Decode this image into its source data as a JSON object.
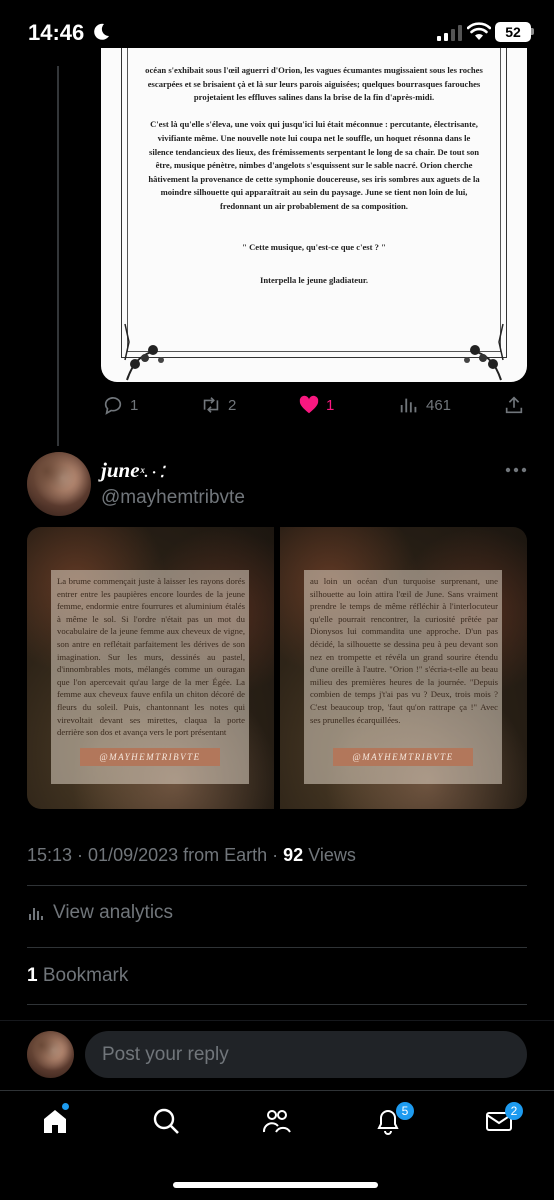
{
  "status": {
    "time": "14:46",
    "battery": "52"
  },
  "card": {
    "paragraphs": [
      "océan s'exhibait sous l'œil aguerri d'Orion, les vagues écumantes mugissaient sous les roches escarpées et se brisaient çà et là sur leurs parois aiguisées; quelques bourrasques farouches projetaient les effluves salines dans la brise de la fin d'après-midi.",
      "C'est là qu'elle s'éleva, une voix qui jusqu'ici lui était méconnue : percutante, électrisante, vivifiante même. Une nouvelle note lui coupa net le souffle, un hoquet résonna dans le silence tendancieux des lieux, des frémissements serpentant le long de sa chair. De tout son être, musique pénètre, nimbes d'angelots s'esquissent sur le sable nacré. Orion cherche hâtivement la provenance de cette symphonie doucereuse, ses iris sombres aux aguets de la moindre silhouette qui apparaîtrait au sein du paysage. June se tient non loin de lui, fredonnant un air probablement de sa composition.",
      "\" Cette musique, qu'est-ce que c'est ? \"",
      "Interpella le jeune gladiateur."
    ]
  },
  "actions_first": {
    "replies": "1",
    "reposts": "2",
    "likes": "1",
    "views": "461"
  },
  "tweet": {
    "name": "june",
    "name_decor": "ˣ. · ⁚",
    "handle": "@mayhemtribvte",
    "photo_left_text": "La brume commençait juste à laisser les rayons dorés entrer entre les paupières encore lourdes de la jeune femme, endormie entre fourrures et aluminium étalés à même le sol. Si l'ordre n'était pas un mot du vocabulaire de la jeune femme aux cheveux de vigne, son antre en reflétait parfaitement les dérives de son imagination. Sur les murs, dessinés au pastel, d'innombrables mots, mélangés comme un ouragan que l'on apercevait qu'au large de la mer Égée. La femme aux cheveux fauve enfila un chiton décoré de fleurs du soleil. Puis, chantonnant les notes qui virevoltait devant ses mirettes, claqua la porte derrière son dos et avança vers le port présentant",
    "photo_right_text": "au loin un océan d'un turquoise surprenant, une silhouette au loin attira l'œil de June. Sans vraiment prendre le temps de même réfléchir à l'interlocuteur qu'elle pourrait rencontrer, la curiosité prêtée par Dionysos lui commandita une approche. D'un pas décidé, la silhouette se dessina peu à peu devant son nez en trompette et révéla un grand sourire étendu d'une oreille à l'autre. \"Orion !\" s'écria-t-elle au beau milieu des premières heures de la journée. \"Depuis combien de temps j't'ai pas vu ? Deux, trois mois ? C'est beaucoup trop, 'faut qu'on rattrape ça !\" Avec ses prunelles écarquillées.",
    "watermark": "@MAYHEMTRIBVTE",
    "meta_prefix": "15:13 · 01/09/2023 from Earth · ",
    "meta_views_count": "92",
    "meta_views_label": " Views",
    "analytics_label": "View analytics",
    "bookmark_count": "1",
    "bookmark_label": " Bookmark"
  },
  "reply": {
    "placeholder": "Post your reply"
  },
  "tabs": {
    "notifications_badge": "5",
    "messages_badge": "2"
  },
  "colors": {
    "accent": "#1d9bf0",
    "like": "#f91880",
    "muted": "#71767b"
  }
}
